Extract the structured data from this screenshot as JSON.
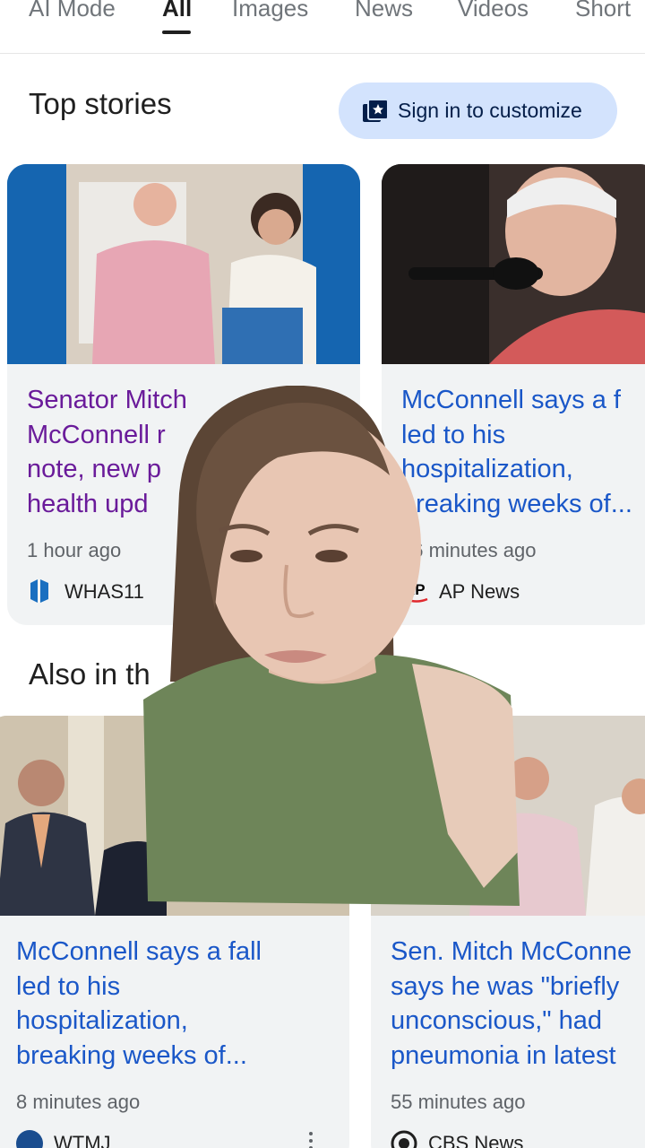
{
  "tabs": [
    {
      "label": "AI Mode",
      "active": false
    },
    {
      "label": "All",
      "active": true
    },
    {
      "label": "Images",
      "active": false
    },
    {
      "label": "News",
      "active": false
    },
    {
      "label": "Videos",
      "active": false
    },
    {
      "label": "Short",
      "active": false
    }
  ],
  "top_stories": {
    "title": "Top stories",
    "signin_label": "Sign in to customize",
    "cards": [
      {
        "headline": "Senator Mitch McConnell r... note, new p... health upd...",
        "headline_lines": [
          "Senator Mitch",
          "McConnell r",
          "note, new p",
          "health upd"
        ],
        "time": "1 hour ago",
        "source": "WHAS11"
      },
      {
        "headline_lines": [
          "McConnell says a f",
          "led to his",
          "hospitalization,",
          "breaking weeks of..."
        ],
        "time": "56 minutes ago",
        "source": "AP News"
      }
    ]
  },
  "also_in_news": {
    "title": "Also in th",
    "cards": [
      {
        "headline_lines": [
          "McConnell says a fall",
          "led to his",
          "hospitalization,",
          "breaking weeks of..."
        ],
        "time": "8 minutes ago",
        "source": "WTMJ"
      },
      {
        "headline_lines": [
          "Sen. Mitch McConne",
          "says he was \"briefly",
          "unconscious,\" had",
          "pneumonia in latest"
        ],
        "time": "55 minutes ago",
        "source": "CBS News"
      }
    ]
  },
  "colors": {
    "link": "#1a57c8",
    "visited": "#6a1b9a",
    "card_bg": "#f1f3f4",
    "button_bg": "#d3e3fd"
  }
}
